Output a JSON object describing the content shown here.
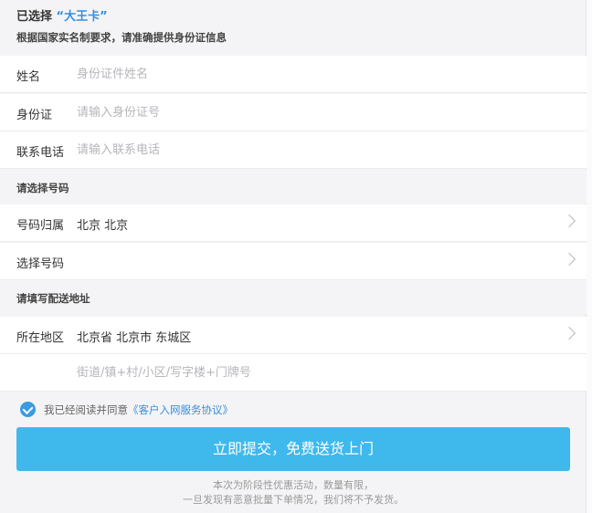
{
  "header": {
    "selected_prefix": "已选择",
    "card_name": "“大王卡”",
    "subtitle": "根据国家实名制要求，请准确提供身份证信息"
  },
  "identity": {
    "name_label": "姓名",
    "name_placeholder": "身份证件姓名",
    "id_label": "身份证",
    "id_placeholder": "请输入身份证号",
    "phone_label": "联系电话",
    "phone_placeholder": "请输入联系电话"
  },
  "number_section": {
    "title": "请选择号码",
    "location_label": "号码归属",
    "location_value": "北京 北京",
    "choose_label": "选择号码"
  },
  "address_section": {
    "title": "请填写配送地址",
    "region_label": "所在地区",
    "region_value": "北京省 北京市 东城区",
    "street_placeholder": "街道/镇+村/小区/写字楼+门牌号"
  },
  "agreement": {
    "text": "我已经阅读并同意",
    "link": "《客户入网服务协议》",
    "checked": true
  },
  "submit_label": "立即提交，免费送货上门",
  "notice": {
    "line1": "本次为阶段性优惠活动，数量有限，",
    "line2": "一旦发现有恶意批量下单情况，我们将不予发货。"
  },
  "colors": {
    "accent": "#3a8fd9",
    "button": "#3fb8ec",
    "checkbox": "#3a9be0"
  }
}
